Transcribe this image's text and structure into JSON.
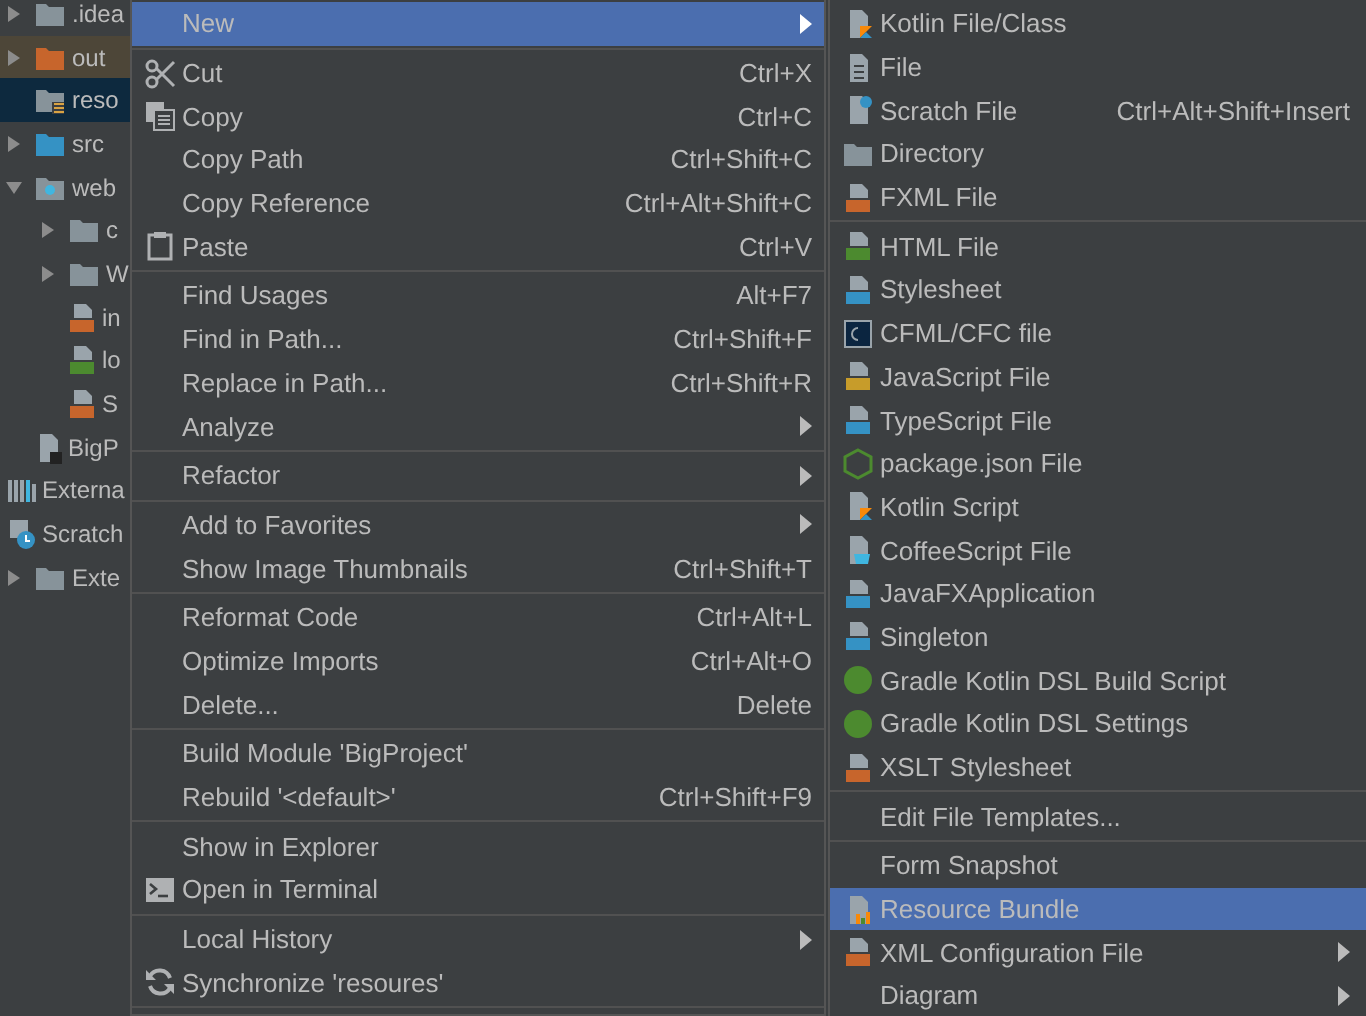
{
  "project_tree": {
    "project_children": [
      {
        "label": ".idea",
        "expanded": false,
        "selected": false,
        "excluded": false
      },
      {
        "label": "out",
        "expanded": false,
        "selected": false,
        "excluded": true
      },
      {
        "label": "reso",
        "selected": true,
        "excluded": false
      },
      {
        "label": "src",
        "expanded": false,
        "selected": false,
        "excluded": false
      },
      {
        "label": "web",
        "expanded": true,
        "selected": false,
        "excluded": false,
        "children": [
          {
            "label": "c",
            "expanded": false,
            "selected": false,
            "excluded": false
          },
          {
            "label": "W",
            "expanded": false,
            "selected": false,
            "excluded": false
          },
          {
            "label": "in",
            "selected": false,
            "excluded": false
          },
          {
            "label": "lo",
            "selected": false,
            "excluded": false
          },
          {
            "label": "S",
            "selected": false,
            "excluded": false
          }
        ]
      },
      {
        "label": "BigP",
        "selected": false,
        "excluded": false
      }
    ],
    "roots": [
      {
        "label": "Externa",
        "selected": false,
        "excluded": false
      },
      {
        "label": "Scratch",
        "selected": false,
        "excluded": false,
        "children": [
          {
            "label": "Exte",
            "expanded": false,
            "selected": false,
            "excluded": false
          }
        ]
      }
    ]
  },
  "context_menu": {
    "items": [
      {
        "kind": "item",
        "label": "New",
        "submenu": true,
        "selected": true
      },
      {
        "kind": "separator"
      },
      {
        "kind": "item",
        "label": "Cut",
        "shortcut": "Ctrl+X",
        "submenu": false,
        "selected": false
      },
      {
        "kind": "item",
        "label": "Copy",
        "shortcut": "Ctrl+C",
        "submenu": false,
        "selected": false
      },
      {
        "kind": "item",
        "label": "Copy Path",
        "shortcut": "Ctrl+Shift+C",
        "submenu": false,
        "selected": false
      },
      {
        "kind": "item",
        "label": "Copy Reference",
        "shortcut": "Ctrl+Alt+Shift+C",
        "submenu": false,
        "selected": false
      },
      {
        "kind": "item",
        "label": "Paste",
        "shortcut": "Ctrl+V",
        "submenu": false,
        "selected": false
      },
      {
        "kind": "separator"
      },
      {
        "kind": "item",
        "label": "Find Usages",
        "shortcut": "Alt+F7",
        "submenu": false,
        "selected": false
      },
      {
        "kind": "item",
        "label": "Find in Path...",
        "shortcut": "Ctrl+Shift+F",
        "submenu": false,
        "selected": false
      },
      {
        "kind": "item",
        "label": "Replace in Path...",
        "shortcut": "Ctrl+Shift+R",
        "submenu": false,
        "selected": false
      },
      {
        "kind": "item",
        "label": "Analyze",
        "submenu": true,
        "selected": false
      },
      {
        "kind": "separator"
      },
      {
        "kind": "item",
        "label": "Refactor",
        "submenu": true,
        "selected": false
      },
      {
        "kind": "separator"
      },
      {
        "kind": "item",
        "label": "Add to Favorites",
        "submenu": true,
        "selected": false
      },
      {
        "kind": "item",
        "label": "Show Image Thumbnails",
        "shortcut": "Ctrl+Shift+T",
        "submenu": false,
        "selected": false
      },
      {
        "kind": "separator"
      },
      {
        "kind": "item",
        "label": "Reformat Code",
        "shortcut": "Ctrl+Alt+L",
        "submenu": false,
        "selected": false
      },
      {
        "kind": "item",
        "label": "Optimize Imports",
        "shortcut": "Ctrl+Alt+O",
        "submenu": false,
        "selected": false
      },
      {
        "kind": "item",
        "label": "Delete...",
        "shortcut": "Delete",
        "submenu": false,
        "selected": false
      },
      {
        "kind": "separator"
      },
      {
        "kind": "item",
        "label": "Build Module 'BigProject'",
        "submenu": false,
        "selected": false
      },
      {
        "kind": "item",
        "label": "Rebuild '<default>'",
        "shortcut": "Ctrl+Shift+F9",
        "submenu": false,
        "selected": false
      },
      {
        "kind": "separator"
      },
      {
        "kind": "item",
        "label": "Show in Explorer",
        "submenu": false,
        "selected": false
      },
      {
        "kind": "item",
        "label": "Open in Terminal",
        "submenu": false,
        "selected": false
      },
      {
        "kind": "separator"
      },
      {
        "kind": "item",
        "label": "Local History",
        "submenu": true,
        "selected": false
      },
      {
        "kind": "item",
        "label": "Synchronize 'resoures'",
        "submenu": false,
        "selected": false
      },
      {
        "kind": "separator"
      }
    ]
  },
  "new_submenu": {
    "items": [
      {
        "kind": "item",
        "label": "Kotlin File/Class",
        "submenu": false,
        "selected": false
      },
      {
        "kind": "item",
        "label": "File",
        "submenu": false,
        "selected": false
      },
      {
        "kind": "item",
        "label": "Scratch File",
        "shortcut": "Ctrl+Alt+Shift+Insert",
        "submenu": false,
        "selected": false
      },
      {
        "kind": "item",
        "label": "Directory",
        "submenu": false,
        "selected": false
      },
      {
        "kind": "item",
        "label": "FXML File",
        "submenu": false,
        "selected": false
      },
      {
        "kind": "separator"
      },
      {
        "kind": "item",
        "label": "HTML File",
        "submenu": false,
        "selected": false
      },
      {
        "kind": "item",
        "label": "Stylesheet",
        "submenu": false,
        "selected": false
      },
      {
        "kind": "item",
        "label": "CFML/CFC file",
        "submenu": false,
        "selected": false
      },
      {
        "kind": "item",
        "label": "JavaScript File",
        "submenu": false,
        "selected": false
      },
      {
        "kind": "item",
        "label": "TypeScript File",
        "submenu": false,
        "selected": false
      },
      {
        "kind": "item",
        "label": "package.json File",
        "submenu": false,
        "selected": false
      },
      {
        "kind": "item",
        "label": "Kotlin Script",
        "submenu": false,
        "selected": false
      },
      {
        "kind": "item",
        "label": "CoffeeScript File",
        "submenu": false,
        "selected": false
      },
      {
        "kind": "item",
        "label": "JavaFXApplication",
        "submenu": false,
        "selected": false
      },
      {
        "kind": "item",
        "label": "Singleton",
        "submenu": false,
        "selected": false
      },
      {
        "kind": "item",
        "label": "Gradle Kotlin DSL Build Script",
        "submenu": false,
        "selected": false
      },
      {
        "kind": "item",
        "label": "Gradle Kotlin DSL Settings",
        "submenu": false,
        "selected": false
      },
      {
        "kind": "item",
        "label": "XSLT Stylesheet",
        "submenu": false,
        "selected": false
      },
      {
        "kind": "separator"
      },
      {
        "kind": "item",
        "label": "Edit File Templates...",
        "submenu": false,
        "selected": false
      },
      {
        "kind": "separator"
      },
      {
        "kind": "item",
        "label": "Form Snapshot",
        "submenu": false,
        "selected": false
      },
      {
        "kind": "item",
        "label": "Resource Bundle",
        "submenu": false,
        "selected": true
      },
      {
        "kind": "item",
        "label": "XML Configuration File",
        "submenu": true,
        "selected": false
      },
      {
        "kind": "item",
        "label": "Diagram",
        "submenu": true,
        "selected": false
      }
    ]
  }
}
